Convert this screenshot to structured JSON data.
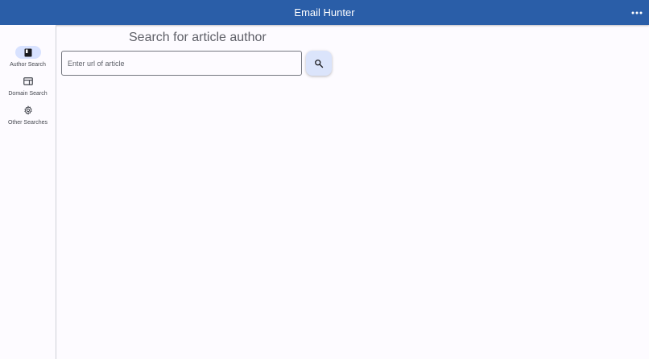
{
  "appbar": {
    "title": "Email Hunter",
    "more_icon": "more-horiz-icon",
    "background": "#2a5ea8"
  },
  "rail": {
    "items": [
      {
        "label": "Author Search",
        "icon": "book-icon",
        "active": true
      },
      {
        "label": "Domain Search",
        "icon": "web-icon",
        "active": false
      },
      {
        "label": "Other Searches",
        "icon": "gear-icon",
        "active": false
      }
    ],
    "active_indicator_color": "#d8e2ff"
  },
  "main": {
    "title": "Search for article author",
    "search_input": {
      "value": "",
      "placeholder": "Enter url of article"
    },
    "search_button_icon": "search-icon"
  }
}
